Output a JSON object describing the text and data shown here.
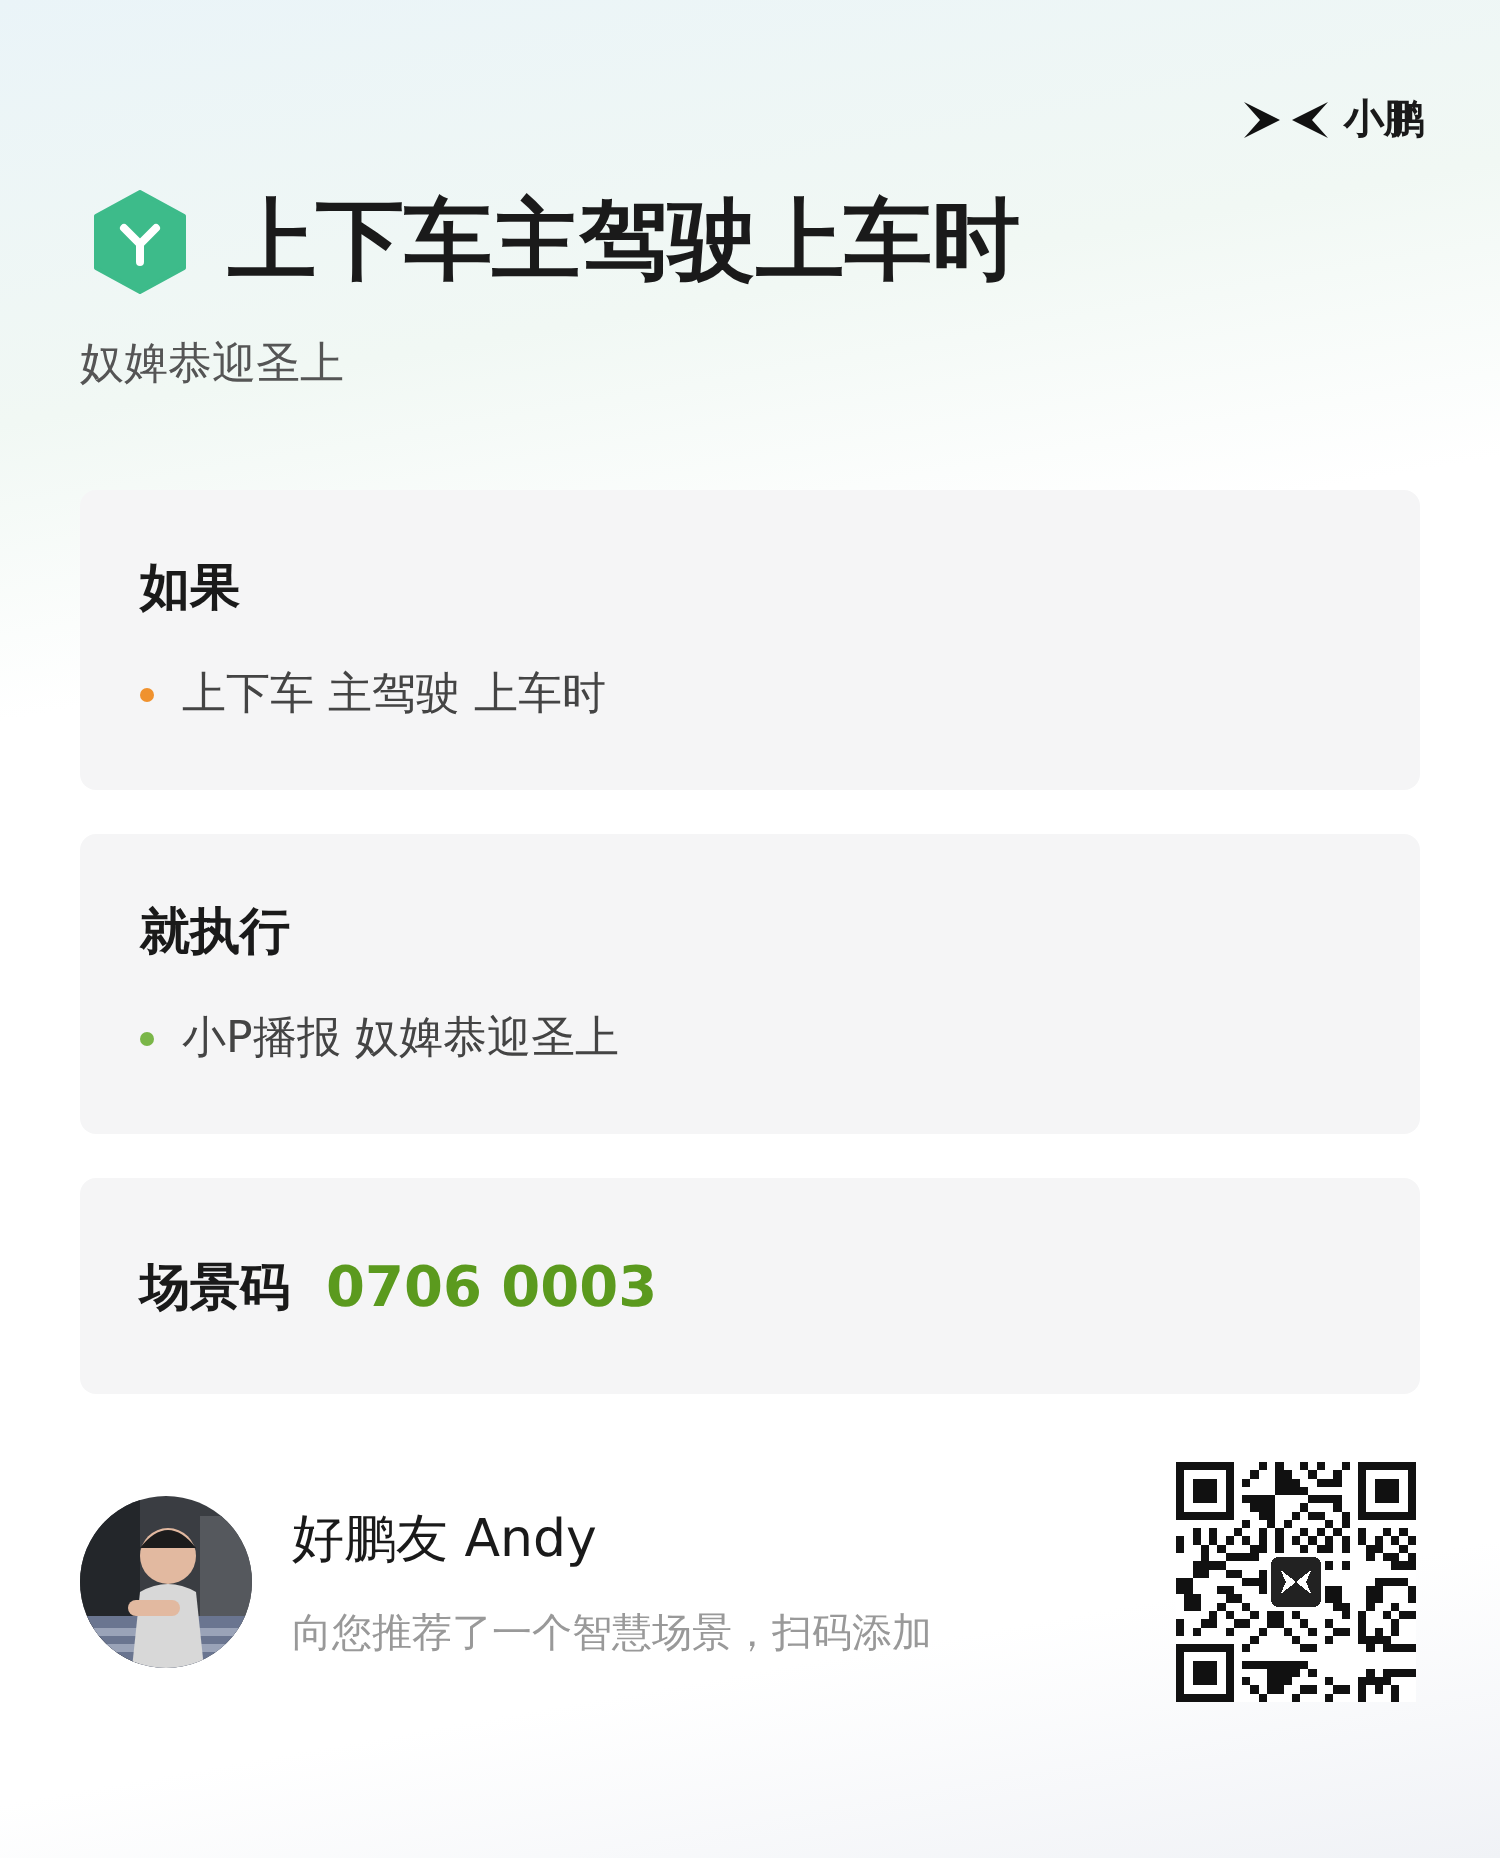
{
  "brand": {
    "name": "小鹏"
  },
  "header": {
    "title": "上下车主驾驶上车时",
    "subtitle": "奴婢恭迎圣上"
  },
  "sections": [
    {
      "kind": "list",
      "heading": "如果",
      "items": [
        {
          "text": "上下车 主驾驶 上车时",
          "color": "#f0922e"
        }
      ]
    },
    {
      "kind": "list",
      "heading": "就执行",
      "items": [
        {
          "text": "小P播报 奴婢恭迎圣上",
          "color": "#7ab648"
        }
      ]
    },
    {
      "kind": "code",
      "heading": "场景码",
      "value": "0706 0003"
    }
  ],
  "footer": {
    "name": "好鹏友 Andy",
    "message": "向您推荐了一个智慧场景，扫码添加"
  }
}
